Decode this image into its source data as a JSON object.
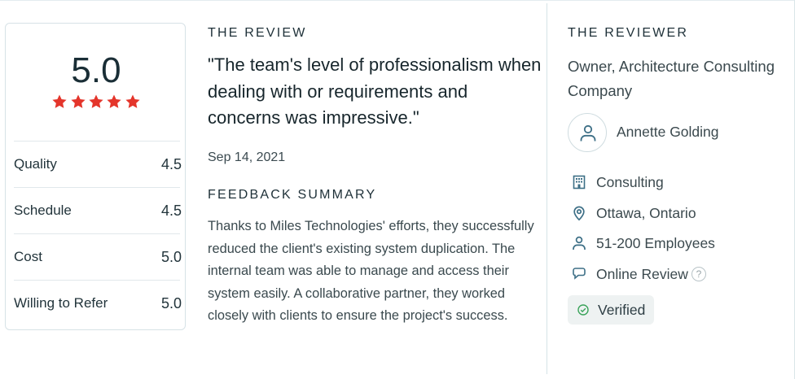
{
  "rating": {
    "overall": "5.0",
    "stars": 5,
    "star_color": "#e4352b",
    "rows": [
      {
        "label": "Quality",
        "value": "4.5"
      },
      {
        "label": "Schedule",
        "value": "4.5"
      },
      {
        "label": "Cost",
        "value": "5.0"
      },
      {
        "label": "Willing to Refer",
        "value": "5.0"
      }
    ]
  },
  "review": {
    "heading": "THE REVIEW",
    "quote": "\"The team's level of professionalism when dealing with or requirements and concerns was impressive.\"",
    "date": "Sep 14, 2021",
    "summary_heading": "FEEDBACK SUMMARY",
    "summary": "Thanks to Miles Technologies' efforts, they successfully reduced the client's existing system duplication. The internal team was able to manage and access their system easily. A collaborative partner, they worked closely with clients to ensure the project's success."
  },
  "reviewer": {
    "heading": "THE REVIEWER",
    "title": "Owner, Architecture Consulting Company",
    "name": "Annette Golding",
    "details": [
      {
        "icon": "building-icon",
        "text": "Consulting"
      },
      {
        "icon": "location-pin-icon",
        "text": "Ottawa, Ontario"
      },
      {
        "icon": "person-icon",
        "text": "51-200 Employees"
      },
      {
        "icon": "chat-bubble-icon",
        "text": "Online Review"
      }
    ],
    "help_glyph": "?",
    "verified_label": "Verified",
    "icon_color": "#3d6f86",
    "verified_color": "#3aa35a"
  }
}
